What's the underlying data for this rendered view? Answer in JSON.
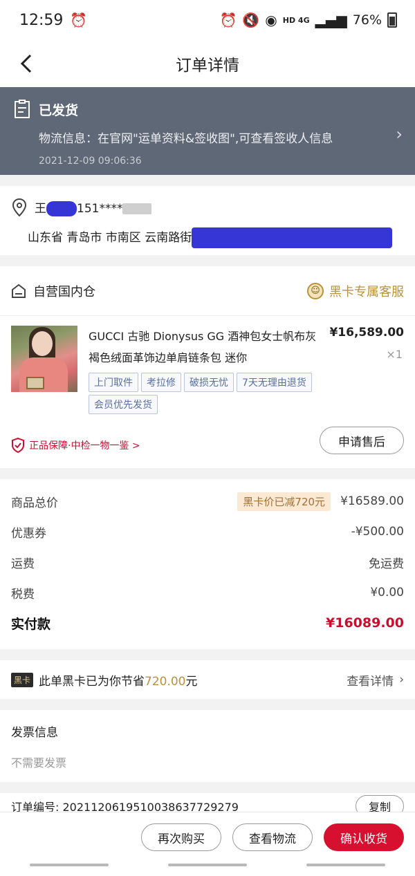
{
  "status_bar": {
    "time": "12:59",
    "battery": "76%",
    "network": "HD 4G"
  },
  "nav": {
    "title": "订单详情"
  },
  "shipment": {
    "status": "已发货",
    "info": "物流信息：在官网\"运单资料&签收图\",可查看签收人信息",
    "time": "2021-12-09 09:06:36"
  },
  "address": {
    "name_prefix": "王",
    "phone_prefix": "151****",
    "address_prefix": "山东省 青岛市 市南区 云南路街"
  },
  "store": {
    "name": "自营国内仓",
    "service": "黑卡专属客服"
  },
  "product": {
    "name": "GUCCI 古驰 Dionysus GG 酒神包女士帆布灰褐色绒面革饰边单肩链条包 迷你",
    "price": "¥16,589.00",
    "qty": "×1",
    "tags": [
      "上门取件",
      "考拉修",
      "破损无忧",
      "7天无理由退货",
      "会员优先发货"
    ],
    "guarantee": "正品保障·中检一物一鉴 >",
    "after_sale": "申请售后"
  },
  "pricing": {
    "goods_total_label": "商品总价",
    "black_card_discount": "黑卡价已减720元",
    "goods_total": "¥16589.00",
    "coupon_label": "优惠券",
    "coupon": "-¥500.00",
    "shipping_label": "运费",
    "shipping": "免运费",
    "tax_label": "税费",
    "tax": "¥0.00",
    "paid_label": "实付款",
    "paid": "¥16089.00"
  },
  "black_card": {
    "badge": "黑卡",
    "text_before": "此单黑卡已为你节省",
    "amount": "720.00",
    "text_after": "元",
    "link": "查看详情"
  },
  "invoice": {
    "title": "发票信息",
    "value": "不需要发票"
  },
  "order": {
    "label": "订单编号: 2021120619510038637729279",
    "copy": "复制"
  },
  "actions": {
    "buy_again": "再次购买",
    "view_logistics": "查看物流",
    "confirm_receipt": "确认收货"
  }
}
